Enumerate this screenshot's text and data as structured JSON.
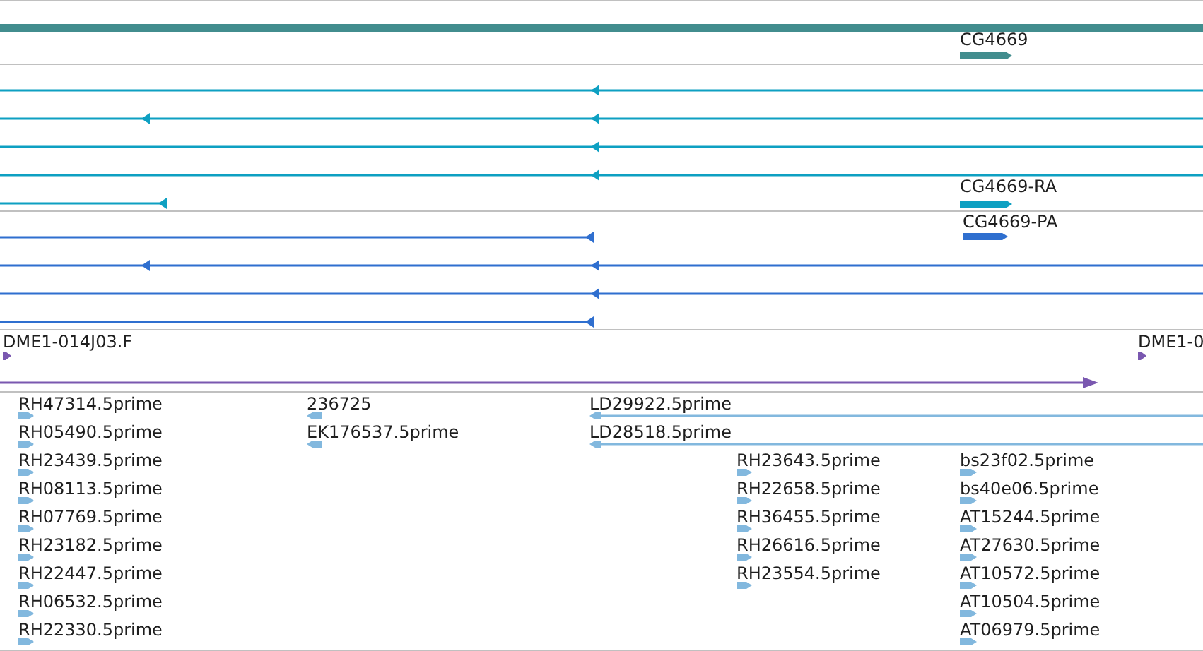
{
  "tracks": [
    {
      "kind": "gene",
      "features": [
        {
          "label": "CG4669",
          "reverse": false
        }
      ]
    },
    {
      "kind": "transcript",
      "features": [
        {
          "label": "CG4669-RA",
          "reverse": false
        }
      ]
    },
    {
      "kind": "protein",
      "features": [
        {
          "label": "CG4669-PA",
          "reverse": false
        }
      ]
    },
    {
      "kind": "clone",
      "features": [
        {
          "label": "DME1-014J03.F",
          "reverse": false
        },
        {
          "label": "DME1-0",
          "reverse": false
        }
      ]
    },
    {
      "kind": "est",
      "columns": [
        [
          {
            "label": "RH47314.5prime",
            "reverse": false
          },
          {
            "label": "RH05490.5prime",
            "reverse": false
          },
          {
            "label": "RH23439.5prime",
            "reverse": false
          },
          {
            "label": "RH08113.5prime",
            "reverse": false
          },
          {
            "label": "RH07769.5prime",
            "reverse": false
          },
          {
            "label": "RH23182.5prime",
            "reverse": false
          },
          {
            "label": "RH22447.5prime",
            "reverse": false
          },
          {
            "label": "RH06532.5prime",
            "reverse": false
          },
          {
            "label": "RH22330.5prime",
            "reverse": false
          }
        ],
        [
          {
            "label": "236725",
            "reverse": true
          },
          {
            "label": "EK176537.5prime",
            "reverse": true
          }
        ],
        [
          {
            "label": "LD29922.5prime",
            "reverse": true
          },
          {
            "label": "LD28518.5prime",
            "reverse": true
          }
        ],
        [
          {
            "label": "RH23643.5prime",
            "reverse": false
          },
          {
            "label": "RH22658.5prime",
            "reverse": false
          },
          {
            "label": "RH36455.5prime",
            "reverse": false
          },
          {
            "label": "RH26616.5prime",
            "reverse": false
          },
          {
            "label": "RH23554.5prime",
            "reverse": false
          }
        ],
        [
          {
            "label": "bs23f02.5prime",
            "reverse": false
          },
          {
            "label": "bs40e06.5prime",
            "reverse": false
          },
          {
            "label": "AT15244.5prime",
            "reverse": false
          },
          {
            "label": "AT27630.5prime",
            "reverse": false
          },
          {
            "label": "AT10572.5prime",
            "reverse": false
          },
          {
            "label": "AT10504.5prime",
            "reverse": false
          },
          {
            "label": "AT06979.5prime",
            "reverse": false
          }
        ]
      ]
    }
  ]
}
